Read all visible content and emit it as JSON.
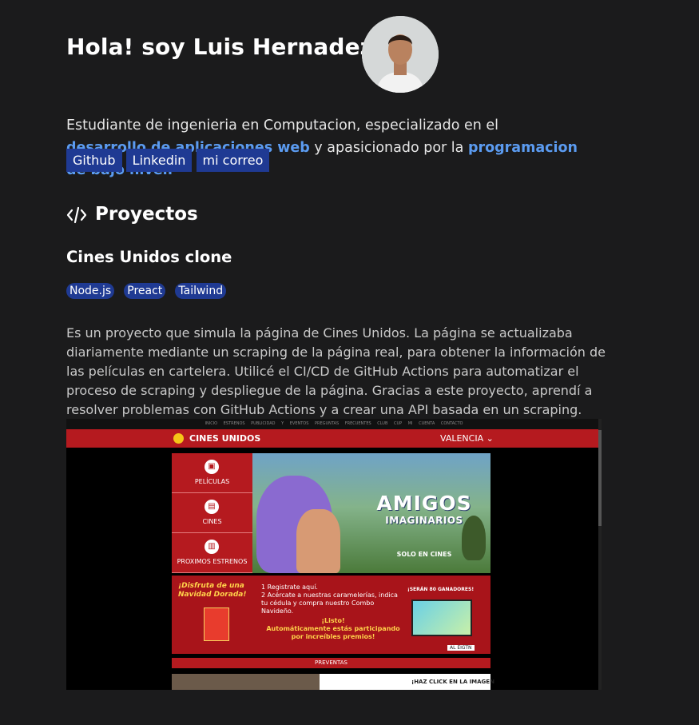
{
  "header": {
    "title": "Hola! soy Luis Hernadez",
    "bio_part1": "Estudiante de ingenieria en Computacion, especializado en el ",
    "bio_hl1": "desarrollo de aplicaciones web",
    "bio_part2": " y apasicionado por la ",
    "bio_hl2": "programacion de bajo nivel."
  },
  "links": [
    {
      "label": "Github"
    },
    {
      "label": "Linkedin"
    },
    {
      "label": "mi correo"
    }
  ],
  "projects_section": {
    "title": "Proyectos",
    "icon": "code-icon"
  },
  "project": {
    "title": "Cines Unidos clone",
    "tags": [
      "Node.js",
      "Preact",
      "Tailwind"
    ],
    "description": "Es un proyecto que simula la página de Cines Unidos. La página se actualizaba diariamente mediante un scraping de la página real, para obtener la información de las películas en cartelera. Utilicé el CI/CD de GitHub Actions para automatizar el proceso de scraping y despliegue de la página. Gracias a este proyecto, aprendí a resolver problemas con GitHub Actions y a crear una API basada en un scraping."
  },
  "screenshot": {
    "topnav": "INICIO ESTRENOS PUBLICIDAD Y EVENTOS PREGUNTAS FRECUENTES CLUB CUP MI CUENTA CONTACTO",
    "brand": "CINES UNIDOS",
    "city": "VALENCIA",
    "side_items": [
      {
        "label": "PELÍCULAS",
        "icon": "film-icon"
      },
      {
        "label": "CINES",
        "icon": "cinema-icon"
      },
      {
        "label": "PROXIMOS ESTRENOS",
        "icon": "clapper-icon"
      }
    ],
    "banner_title": "AMIGOS",
    "banner_subtitle": "IMAGINARIOS",
    "banner_tag": "SOLO EN CINES",
    "promo_left": "¡Disfruta de una Navidad Dorada!",
    "promo_step1": "1  Registrate aquí.",
    "promo_step2": "2  Acércate a nuestras caramelerías, indica tu cédula y compra nuestro Combo Navideño.",
    "promo_ready": "¡Listo!",
    "promo_ready2": "Automáticamente estás participando por increíbles premios!",
    "promo_right": "¡SERÁN 80 GANADORES!",
    "promo_brand": "AL EIGTN",
    "presale": "PREVENTAS",
    "strip_text": "¡HAZ CLICK EN LA IMAGEN"
  },
  "colors": {
    "background": "#1b1b1c",
    "accent_link": "#5b9bf0",
    "button_bg": "#1f3a93",
    "cines_red": "#b51a1f"
  }
}
